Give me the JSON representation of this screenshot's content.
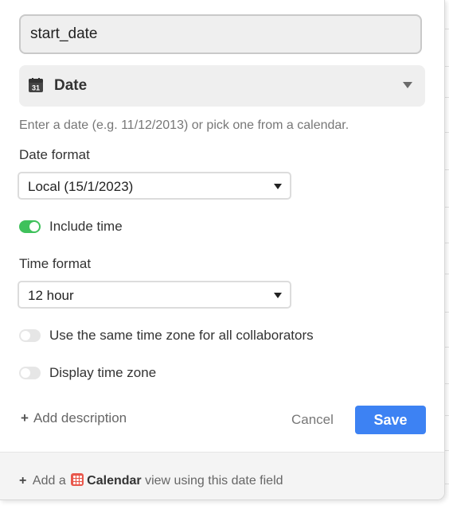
{
  "field": {
    "name_value": "start_date",
    "type_label": "Date",
    "type_icon": "calendar-31-icon",
    "hint": "Enter a date (e.g. 11/12/2013) or pick one from a calendar."
  },
  "date_format": {
    "label": "Date format",
    "value": "Local (15/1/2023)"
  },
  "include_time": {
    "label": "Include time",
    "enabled": true
  },
  "time_format": {
    "label": "Time format",
    "value": "12 hour"
  },
  "same_time_zone": {
    "label": "Use the same time zone for all collaborators",
    "enabled": false
  },
  "display_time_zone": {
    "label": "Display time zone",
    "enabled": false
  },
  "actions": {
    "add_description": "Add description",
    "cancel": "Cancel",
    "save": "Save"
  },
  "footer": {
    "prefix": "Add a",
    "view_name": "Calendar",
    "suffix": "view using this date field"
  },
  "colors": {
    "accent": "#3d82f3",
    "toggle_on": "#3fc15b",
    "calendar_icon": "#e8574b"
  }
}
